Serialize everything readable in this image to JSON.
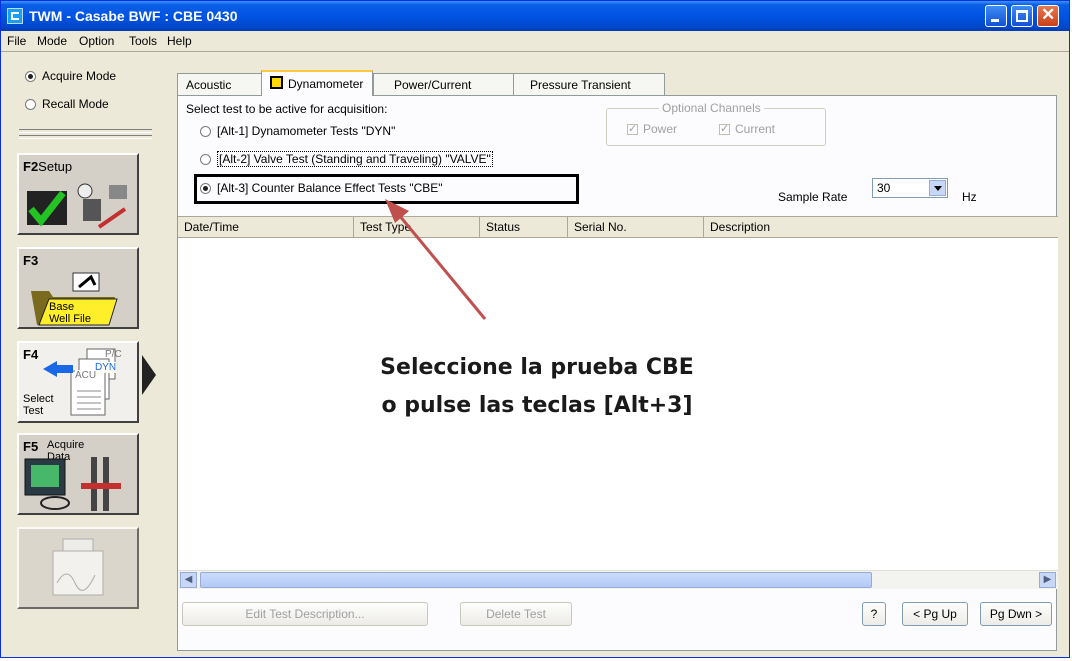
{
  "window": {
    "title": "TWM  -  Casabe BWF : CBE 0430",
    "controls": [
      "minimize",
      "maximize",
      "close"
    ]
  },
  "menu": [
    "File",
    "Mode",
    "Option",
    "Tools",
    "Help"
  ],
  "sidebar": {
    "modes": [
      {
        "label": "Acquire Mode",
        "selected": true
      },
      {
        "label": "Recall Mode",
        "selected": false
      }
    ],
    "buttons": [
      {
        "key": "F2",
        "label": "Setup",
        "icon": "setup-toolbox-icon"
      },
      {
        "key": "F3",
        "label": "Base Well File",
        "icon": "base-well-file-icon"
      },
      {
        "key": "F4",
        "label": "Select Test",
        "icon": "select-test-documents-icon",
        "active": true,
        "doc_tags": [
          "P/C",
          "DYN",
          "ACU"
        ]
      },
      {
        "key": "F5",
        "label": "Acquire Data",
        "icon": "acquire-data-computer-icon"
      },
      {
        "key": "",
        "label": "",
        "icon": "analysis-chart-icon",
        "disabled": true
      }
    ]
  },
  "tabs": [
    {
      "label": "Acoustic",
      "active": false
    },
    {
      "label": "Dynamometer",
      "active": true
    },
    {
      "label": "Power/Current",
      "active": false
    },
    {
      "label": "Pressure Transient",
      "active": false
    }
  ],
  "tests": {
    "prompt": "Select test to be active for acquisition:",
    "options": [
      {
        "label": "[Alt-1] Dynamometer Tests  \"DYN\"",
        "selected": false
      },
      {
        "label": "[Alt-2] Valve Test (Standing and Traveling)  \"VALVE\"",
        "selected": false
      },
      {
        "label": "[Alt-3] Counter Balance Effect Tests  \"CBE\"",
        "selected": true
      }
    ]
  },
  "optional_channels": {
    "legend": "Optional Channels",
    "power": "Power",
    "current": "Current"
  },
  "sample_rate": {
    "label": "Sample Rate",
    "value": "30",
    "unit": "Hz"
  },
  "table": {
    "columns": [
      "Date/Time",
      "Test Type",
      "Status",
      "Serial No.",
      "Description"
    ],
    "rows": []
  },
  "buttons": {
    "edit": "Edit Test Description...",
    "delete": "Delete Test",
    "help": "?",
    "pgup": "< Pg Up",
    "pgdn": "Pg Dwn >"
  },
  "annotation": {
    "line1": "Seleccione la prueba CBE",
    "line2": "o pulse las teclas [Alt+3]",
    "arrow_color": "#c0504d"
  }
}
